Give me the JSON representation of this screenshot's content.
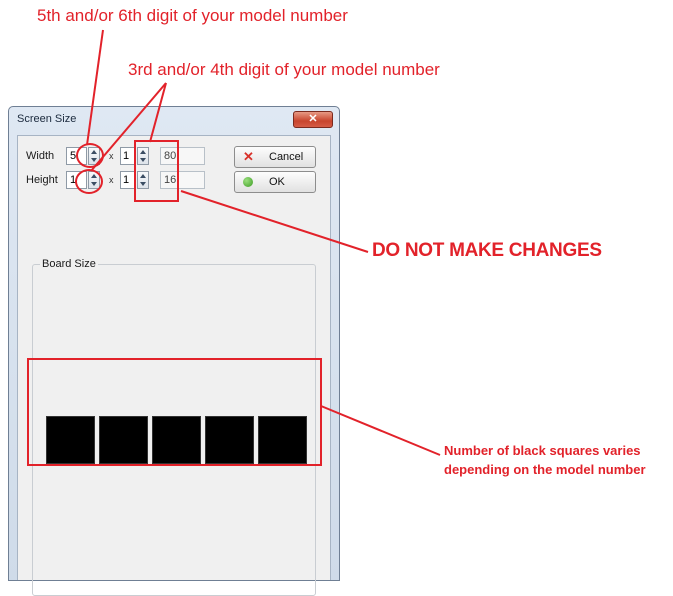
{
  "annotations": {
    "fifth_sixth_digit": "5th and/or 6th digit of your model number",
    "third_fourth_digit": "3rd and/or 4th digit of your model number",
    "do_not_change": "DO NOT MAKE CHANGES",
    "squares_note_line1": "Number of black squares varies",
    "squares_note_line2": "depending on the model number",
    "color": "#e2222a"
  },
  "dialog": {
    "title": "Screen Size",
    "close_glyph": "✕",
    "width_label": "Width",
    "height_label": "Height",
    "width_value": "5",
    "height_value": "1",
    "width_multiplier": "1",
    "height_multiplier": "1",
    "times_sign": "x",
    "width_pixels": "80",
    "height_pixels": "16",
    "cancel_icon": "✕",
    "cancel_label": "Cancel",
    "ok_label": "OK",
    "board_size_label": "Board Size",
    "black_square_count": 5
  }
}
